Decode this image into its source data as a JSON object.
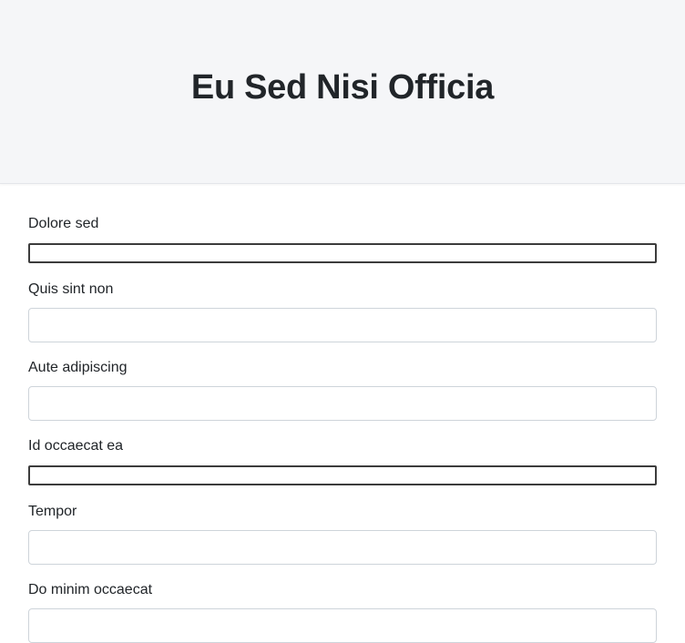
{
  "header": {
    "title": "Eu Sed Nisi Officia"
  },
  "form": {
    "fields": [
      {
        "label": "Dolore sed",
        "value": ""
      },
      {
        "label": "Quis sint non",
        "value": ""
      },
      {
        "label": "Aute adipiscing",
        "value": ""
      },
      {
        "label": "Id occaecat ea",
        "value": ""
      },
      {
        "label": "Tempor",
        "value": ""
      },
      {
        "label": "Do minim occaecat",
        "value": ""
      }
    ]
  }
}
